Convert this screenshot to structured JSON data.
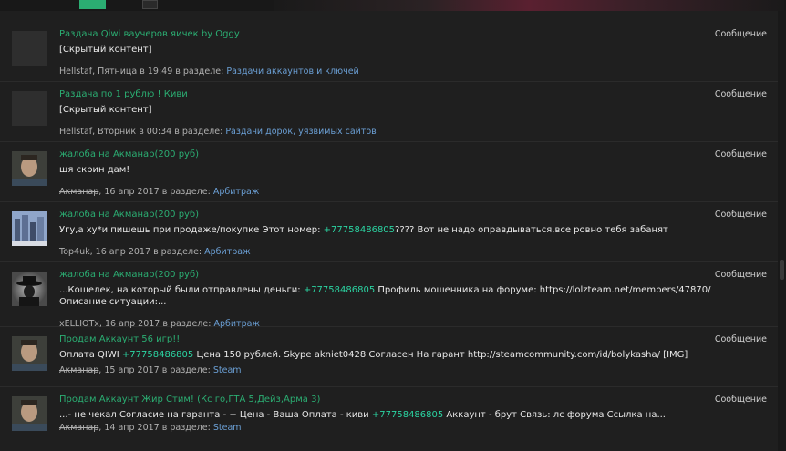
{
  "header": {
    "tab_left_label": "",
    "active_tab": "",
    "banner": "",
    "colors": {
      "accent": "#2bad72",
      "link": "#6b9fd4",
      "phone": "#2bd4a2"
    }
  },
  "results": [
    {
      "title": "Раздача Qiwi ваучеров яичек by Oggy",
      "snippet": "[Скрытый контент]",
      "user": "Hellstaf",
      "user_struck": false,
      "date": "Пятница в 19:49",
      "in_section": "в разделе:",
      "section": "Раздачи аккаунтов и ключей",
      "type": "Сообщение",
      "avatar": "blank"
    },
    {
      "title": "Раздача по 1 рублю ! Киви",
      "snippet": "[Скрытый контент]",
      "user": "Hellstaf",
      "user_struck": false,
      "date": "Вторник в 00:34",
      "in_section": "в разделе:",
      "section": "Раздачи дорок, уязвимых сайтов",
      "type": "Сообщение",
      "avatar": "blank"
    },
    {
      "title": "жалоба на Акманар(200 руб)",
      "snippet": "щя скрин дам!",
      "user": "Акманар",
      "user_struck": true,
      "date": "16 апр 2017",
      "in_section": "в разделе:",
      "section": "Арбитраж",
      "type": "Сообщение",
      "avatar": "face"
    },
    {
      "title": "жалоба на Акманар(200 руб)",
      "snippet_pre": "Угу,а ху*и пишешь при продаже/покупке Этот номер: ",
      "phone": "+77758486805",
      "snippet_post": "???? Вот не надо оправдываться,все ровно тебя забанят",
      "user": "Top4uk",
      "user_struck": false,
      "date": "16 апр 2017",
      "in_section": "в разделе:",
      "section": "Арбитраж",
      "type": "Сообщение",
      "avatar": "city"
    },
    {
      "title": "жалоба на Акманар(200 руб)",
      "snippet_pre": "...Кошелек, на который были отправлены деньги: ",
      "phone": "+77758486805",
      "snippet_post": " Профиль мошенника на форуме: https://lolzteam.net/members/47870/ Описание ситуации:...",
      "user": "xELLIOTx",
      "user_struck": false,
      "date": "16 апр 2017",
      "in_section": "в разделе:",
      "section": "Арбитраж",
      "type": "Сообщение",
      "avatar": "hat"
    },
    {
      "title": "Продам Аккаунт 56 игр!!",
      "snippet_pre": "Оплата QIWI ",
      "phone": "+77758486805",
      "snippet_post": " Цена 150 рублей. Skype akniet0428 Согласен На гарант http://steamcommunity.com/id/bolykasha/ [IMG]",
      "user": "Акманар",
      "user_struck": true,
      "date": "15 апр 2017",
      "in_section": "в разделе:",
      "section": "Steam",
      "type": "Сообщение",
      "avatar": "face"
    },
    {
      "title": "Продам Аккаунт Жир Стим! (Кс го,ГТА 5,Дейз,Арма 3)",
      "snippet_pre": "...- не чекал Согласие на гаранта - + Цена - Ваша Оплата - киви ",
      "phone": "+77758486805",
      "snippet_post": " Аккаунт - брут Связь: лс форума Ссылка на...",
      "user": "Акманар",
      "user_struck": true,
      "date": "14 апр 2017",
      "in_section": "в разделе:",
      "section": "Steam",
      "type": "Сообщение",
      "avatar": "face"
    }
  ]
}
